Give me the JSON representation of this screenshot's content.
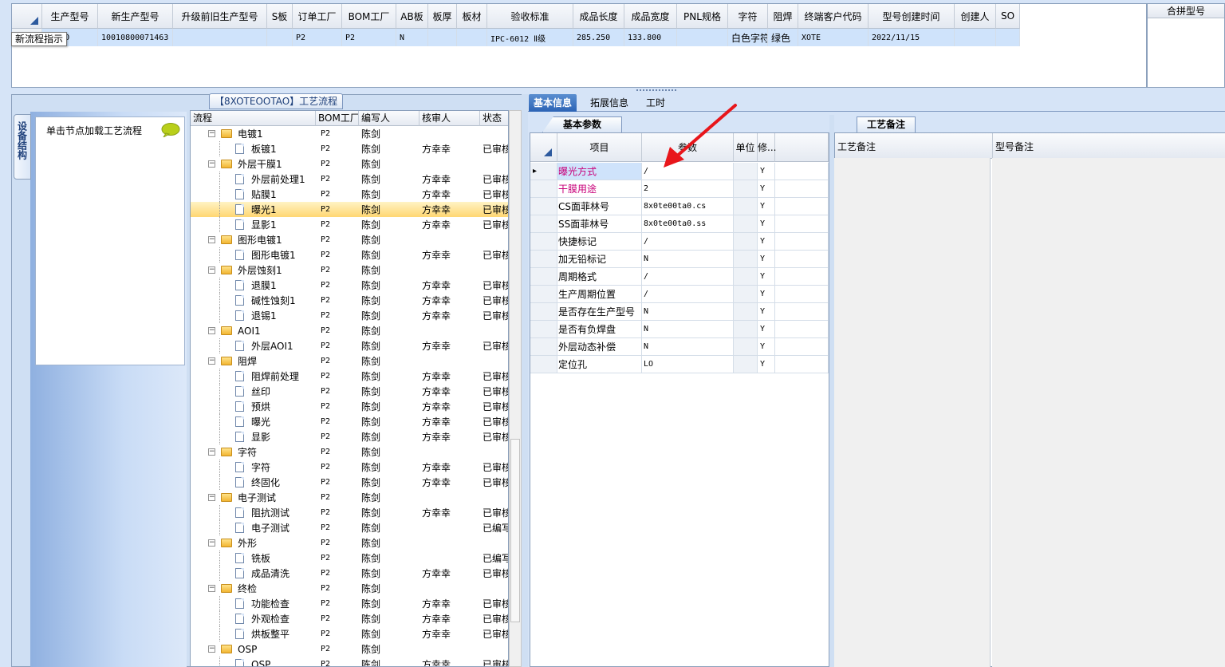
{
  "top_grid": {
    "columns": [
      "生产型号",
      "新生产型号",
      "升级前旧生产型号",
      "S板",
      "订单工厂",
      "BOM工厂",
      "AB板",
      "板厚",
      "板材",
      "验收标准",
      "成品长度",
      "成品宽度",
      "PNL规格",
      "字符",
      "阻焊",
      "终端客户代码",
      "型号创建时间",
      "创建人",
      "SO"
    ],
    "row": [
      "OOTAO",
      "10010800071463",
      "",
      "",
      "P2",
      "P2",
      "N",
      "",
      "",
      "IPC-6012 Ⅱ级",
      "285.250",
      "133.800",
      "",
      "白色字符",
      "绿色",
      "XOTE",
      "2022/11/15",
      "",
      ""
    ]
  },
  "tooltip": "新流程指示",
  "merge_panel_title": "合拼型号",
  "left_vertical_tab": "设备结构",
  "hint_text": "单击节点加载工艺流程",
  "flow_title": "【8XOTEOOTAO】工艺流程",
  "tree": {
    "columns": [
      "流程",
      "BOM工厂",
      "编写人",
      "核审人",
      "状态"
    ],
    "rows": [
      {
        "name": "电镀1",
        "level": 0,
        "bom": "P2",
        "writer": "陈剑",
        "reviewer": "",
        "status": ""
      },
      {
        "name": "板镀1",
        "level": 1,
        "bom": "P2",
        "writer": "陈剑",
        "reviewer": "方幸幸",
        "status": "已审核"
      },
      {
        "name": "外层干膜1",
        "level": 0,
        "bom": "P2",
        "writer": "陈剑",
        "reviewer": "",
        "status": ""
      },
      {
        "name": "外层前处理1",
        "level": 1,
        "bom": "P2",
        "writer": "陈剑",
        "reviewer": "方幸幸",
        "status": "已审核"
      },
      {
        "name": "贴膜1",
        "level": 1,
        "bom": "P2",
        "writer": "陈剑",
        "reviewer": "方幸幸",
        "status": "已审核"
      },
      {
        "name": "曝光1",
        "level": 1,
        "bom": "P2",
        "writer": "陈剑",
        "reviewer": "方幸幸",
        "status": "已审核",
        "selected": true
      },
      {
        "name": "显影1",
        "level": 1,
        "bom": "P2",
        "writer": "陈剑",
        "reviewer": "方幸幸",
        "status": "已审核"
      },
      {
        "name": "图形电镀1",
        "level": 0,
        "bom": "P2",
        "writer": "陈剑",
        "reviewer": "",
        "status": ""
      },
      {
        "name": "图形电镀1",
        "level": 1,
        "bom": "P2",
        "writer": "陈剑",
        "reviewer": "方幸幸",
        "status": "已审核"
      },
      {
        "name": "外层蚀刻1",
        "level": 0,
        "bom": "P2",
        "writer": "陈剑",
        "reviewer": "",
        "status": ""
      },
      {
        "name": "退膜1",
        "level": 1,
        "bom": "P2",
        "writer": "陈剑",
        "reviewer": "方幸幸",
        "status": "已审核"
      },
      {
        "name": "碱性蚀刻1",
        "level": 1,
        "bom": "P2",
        "writer": "陈剑",
        "reviewer": "方幸幸",
        "status": "已审核"
      },
      {
        "name": "退锡1",
        "level": 1,
        "bom": "P2",
        "writer": "陈剑",
        "reviewer": "方幸幸",
        "status": "已审核"
      },
      {
        "name": "AOI1",
        "level": 0,
        "bom": "P2",
        "writer": "陈剑",
        "reviewer": "",
        "status": ""
      },
      {
        "name": "外层AOI1",
        "level": 1,
        "bom": "P2",
        "writer": "陈剑",
        "reviewer": "方幸幸",
        "status": "已审核"
      },
      {
        "name": "阻焊",
        "level": 0,
        "bom": "P2",
        "writer": "陈剑",
        "reviewer": "",
        "status": ""
      },
      {
        "name": "阻焊前处理",
        "level": 1,
        "bom": "P2",
        "writer": "陈剑",
        "reviewer": "方幸幸",
        "status": "已审核"
      },
      {
        "name": "丝印",
        "level": 1,
        "bom": "P2",
        "writer": "陈剑",
        "reviewer": "方幸幸",
        "status": "已审核"
      },
      {
        "name": "预烘",
        "level": 1,
        "bom": "P2",
        "writer": "陈剑",
        "reviewer": "方幸幸",
        "status": "已审核"
      },
      {
        "name": "曝光",
        "level": 1,
        "bom": "P2",
        "writer": "陈剑",
        "reviewer": "方幸幸",
        "status": "已审核"
      },
      {
        "name": "显影",
        "level": 1,
        "bom": "P2",
        "writer": "陈剑",
        "reviewer": "方幸幸",
        "status": "已审核"
      },
      {
        "name": "字符",
        "level": 0,
        "bom": "P2",
        "writer": "陈剑",
        "reviewer": "",
        "status": ""
      },
      {
        "name": "字符",
        "level": 1,
        "bom": "P2",
        "writer": "陈剑",
        "reviewer": "方幸幸",
        "status": "已审核"
      },
      {
        "name": "终固化",
        "level": 1,
        "bom": "P2",
        "writer": "陈剑",
        "reviewer": "方幸幸",
        "status": "已审核"
      },
      {
        "name": "电子测试",
        "level": 0,
        "bom": "P2",
        "writer": "陈剑",
        "reviewer": "",
        "status": ""
      },
      {
        "name": "阻抗测试",
        "level": 1,
        "bom": "P2",
        "writer": "陈剑",
        "reviewer": "方幸幸",
        "status": "已审核"
      },
      {
        "name": "电子测试",
        "level": 1,
        "bom": "P2",
        "writer": "陈剑",
        "reviewer": "",
        "status": "已编写"
      },
      {
        "name": "外形",
        "level": 0,
        "bom": "P2",
        "writer": "陈剑",
        "reviewer": "",
        "status": ""
      },
      {
        "name": "铣板",
        "level": 1,
        "bom": "P2",
        "writer": "陈剑",
        "reviewer": "",
        "status": "已编写"
      },
      {
        "name": "成品清洗",
        "level": 1,
        "bom": "P2",
        "writer": "陈剑",
        "reviewer": "方幸幸",
        "status": "已审核"
      },
      {
        "name": "终检",
        "level": 0,
        "bom": "P2",
        "writer": "陈剑",
        "reviewer": "",
        "status": ""
      },
      {
        "name": "功能检查",
        "level": 1,
        "bom": "P2",
        "writer": "陈剑",
        "reviewer": "方幸幸",
        "status": "已审核"
      },
      {
        "name": "外观检查",
        "level": 1,
        "bom": "P2",
        "writer": "陈剑",
        "reviewer": "方幸幸",
        "status": "已审核"
      },
      {
        "name": "烘板整平",
        "level": 1,
        "bom": "P2",
        "writer": "陈剑",
        "reviewer": "方幸幸",
        "status": "已审核"
      },
      {
        "name": "OSP",
        "level": 0,
        "bom": "P2",
        "writer": "陈剑",
        "reviewer": "",
        "status": ""
      },
      {
        "name": "OSP",
        "level": 1,
        "bom": "P2",
        "writer": "陈剑",
        "reviewer": "方幸幸",
        "status": "已审核"
      }
    ]
  },
  "tabs": {
    "basic": "基本信息",
    "extended": "拓展信息",
    "hours": "工时"
  },
  "basic_param_tab": "基本参数",
  "process_note_tab": "工艺备注",
  "param_grid": {
    "columns": {
      "item": "项目",
      "value": "参数",
      "unit": "单位",
      "modify": "修..."
    },
    "rows": [
      {
        "name": "曝光方式",
        "value": "/",
        "mod": "Y",
        "highlight": true,
        "current": true
      },
      {
        "name": "干膜用途",
        "value": "2",
        "mod": "Y",
        "highlight": true
      },
      {
        "name": "CS面菲林号",
        "value": "8x0te00ta0.cs",
        "mod": "Y"
      },
      {
        "name": "SS面菲林号",
        "value": "8x0te00ta0.ss",
        "mod": "Y"
      },
      {
        "name": "快捷标记",
        "value": "/",
        "mod": "Y"
      },
      {
        "name": "加无铅标记",
        "value": "N",
        "mod": "Y"
      },
      {
        "name": "周期格式",
        "value": "/",
        "mod": "Y"
      },
      {
        "name": "生产周期位置",
        "value": "/",
        "mod": "Y"
      },
      {
        "name": "是否存在生产型号",
        "value": "N",
        "mod": "Y"
      },
      {
        "name": "是否有负焊盘",
        "value": "N",
        "mod": "Y"
      },
      {
        "name": "外层动态补偿",
        "value": "N",
        "mod": "Y"
      },
      {
        "name": "定位孔",
        "value": "LO",
        "mod": "Y"
      }
    ]
  },
  "note_grid": {
    "col1": "工艺备注",
    "col2": "型号备注"
  },
  "colors": {
    "accent": "#2c63b5",
    "selected_row": "#cfe3fb",
    "tree_selected": "#ffd772",
    "highlight_text": "#c8007a",
    "arrow": "#e8161b"
  }
}
